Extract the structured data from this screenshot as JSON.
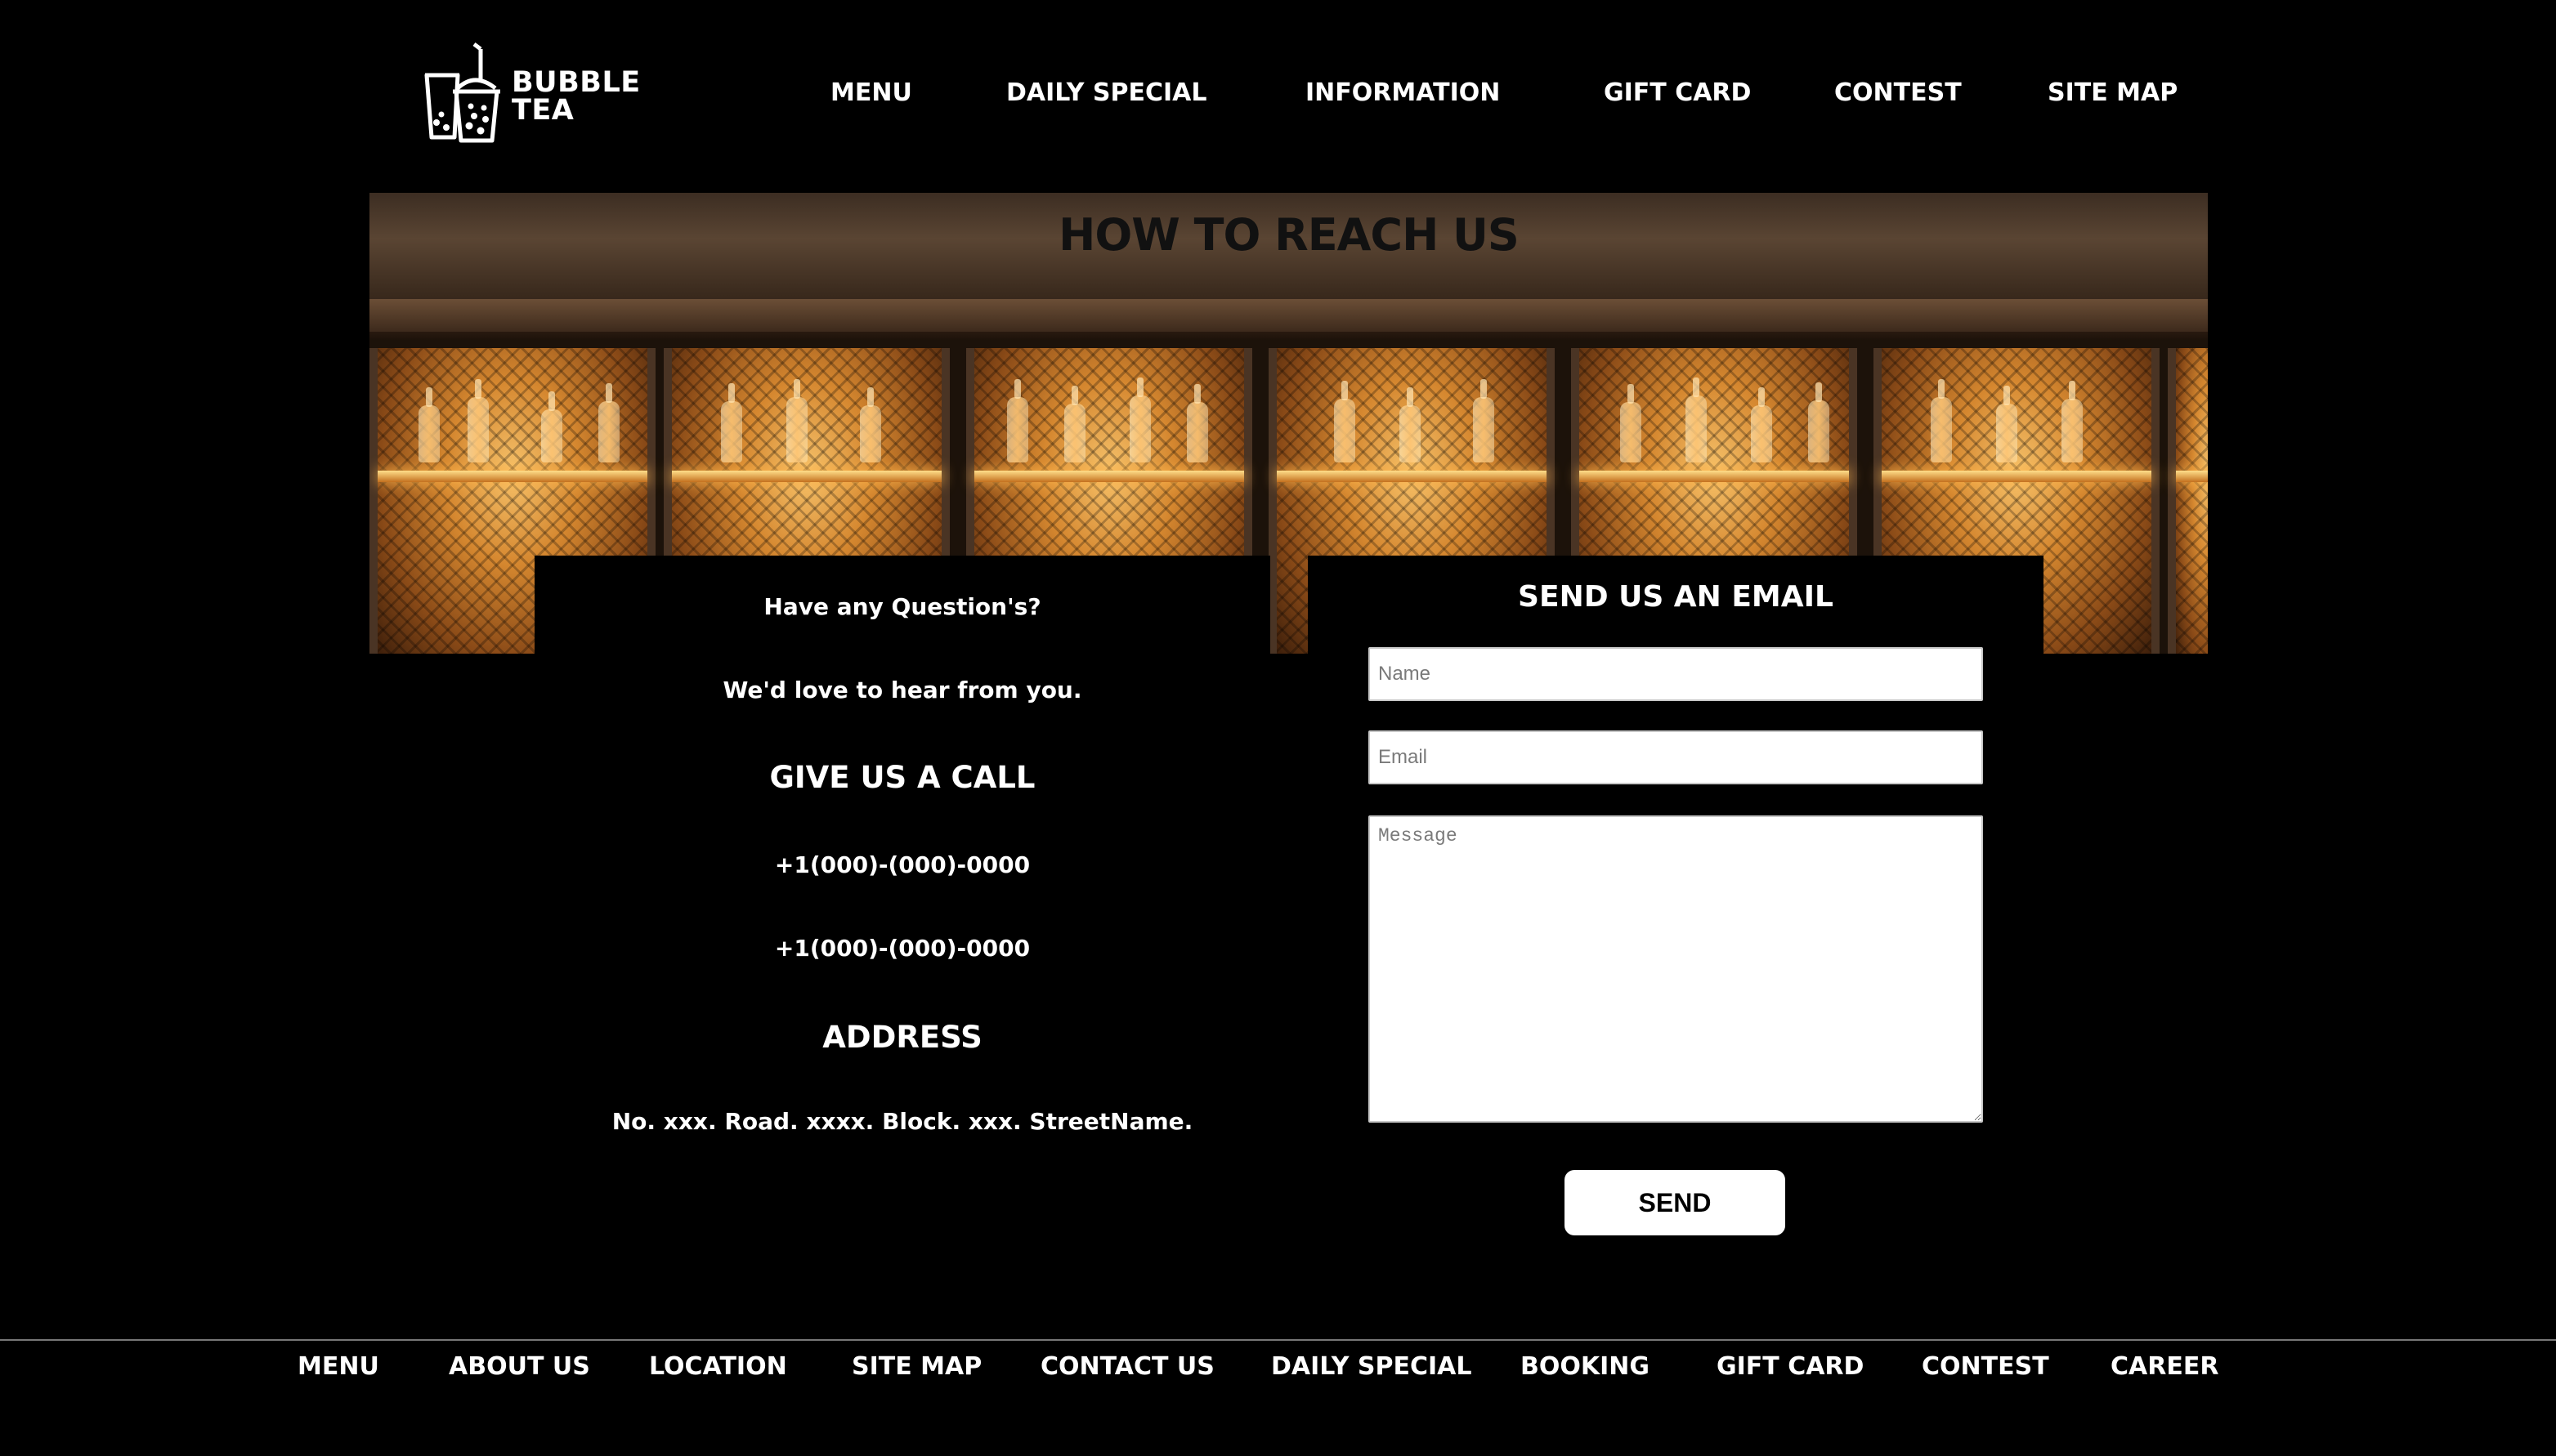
{
  "header": {
    "logo_text_line1": "BUBBLE",
    "logo_text_line2": "TEA",
    "nav": [
      {
        "label": "MENU"
      },
      {
        "label": "DAILY SPECIAL"
      },
      {
        "label": "INFORMATION"
      },
      {
        "label": "GIFT CARD"
      },
      {
        "label": "CONTEST"
      },
      {
        "label": "SITE MAP"
      }
    ]
  },
  "hero": {
    "title": "HOW TO REACH US"
  },
  "contact_info": {
    "question": "Have any Question's?",
    "subtext": "We'd love to hear from you.",
    "call_heading": "GIVE US A CALL",
    "phone_1": "+1(000)-(000)-0000",
    "phone_2": "+1(000)-(000)-0000",
    "address_heading": "ADDRESS",
    "address": "No. xxx. Road. xxxx. Block. xxx. StreetName."
  },
  "email_form": {
    "title": "SEND US AN EMAIL",
    "name_placeholder": "Name",
    "name_value": "",
    "email_placeholder": "Email",
    "email_value": "",
    "message_placeholder": "Message",
    "message_value": "",
    "send_label": "SEND"
  },
  "footer": {
    "links": [
      {
        "label": "MENU"
      },
      {
        "label": "ABOUT US"
      },
      {
        "label": "LOCATION"
      },
      {
        "label": "SITE MAP"
      },
      {
        "label": "CONTACT US"
      },
      {
        "label": "DAILY SPECIAL"
      },
      {
        "label": "BOOKING"
      },
      {
        "label": "GIFT CARD"
      },
      {
        "label": "CONTEST"
      },
      {
        "label": "CAREER"
      }
    ]
  },
  "colors": {
    "background": "#000000",
    "text": "#ffffff",
    "hero_title": "#111111",
    "button_bg": "#ffffff"
  },
  "icons": {
    "logo": "bubble-tea-cups-icon"
  }
}
